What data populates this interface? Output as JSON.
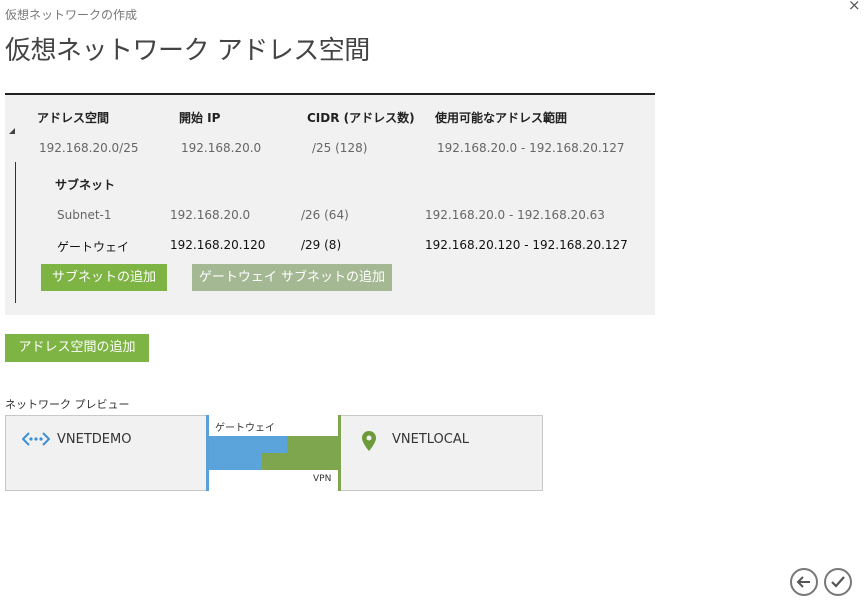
{
  "dialog": {
    "breadcrumb": "仮想ネットワークの作成",
    "title": "仮想ネットワーク アドレス空間",
    "close_icon": "×"
  },
  "address_table": {
    "headers": [
      "アドレス空間",
      "開始 IP",
      "CIDR (アドレス数)",
      "使用可能なアドレス範囲"
    ],
    "row": {
      "address_space": "192.168.20.0/25",
      "start_ip": "192.168.20.0",
      "cidr": "/25 (128)",
      "range": "192.168.20.0 - 192.168.20.127"
    },
    "subnet_header": "サブネット",
    "subnets": [
      {
        "name": "Subnet-1",
        "start_ip": "192.168.20.0",
        "cidr": "/26 (64)",
        "range": "192.168.20.0 - 192.168.20.63"
      },
      {
        "name": "ゲートウェイ",
        "start_ip": "192.168.20.120",
        "cidr": "/29 (8)",
        "range": "192.168.20.120 - 192.168.20.127"
      }
    ],
    "add_subnet_label": "サブネットの追加",
    "add_gateway_subnet_label": "ゲートウェイ サブネットの追加"
  },
  "add_address_space_label": "アドレス空間の追加",
  "preview": {
    "label": "ネットワーク プレビュー",
    "left_network": "VNETDEMO",
    "gateway_label": "ゲートウェイ",
    "vpn_label": "VPN",
    "right_network": "VNETLOCAL",
    "colors": {
      "blue": "#5ba3db",
      "green": "#7da64e"
    }
  },
  "nav": {
    "back_icon": "arrow-left-icon",
    "ok_icon": "checkmark-icon"
  },
  "colors": {
    "primary_button": "#7db443",
    "disabled_button": "#a5b894"
  }
}
